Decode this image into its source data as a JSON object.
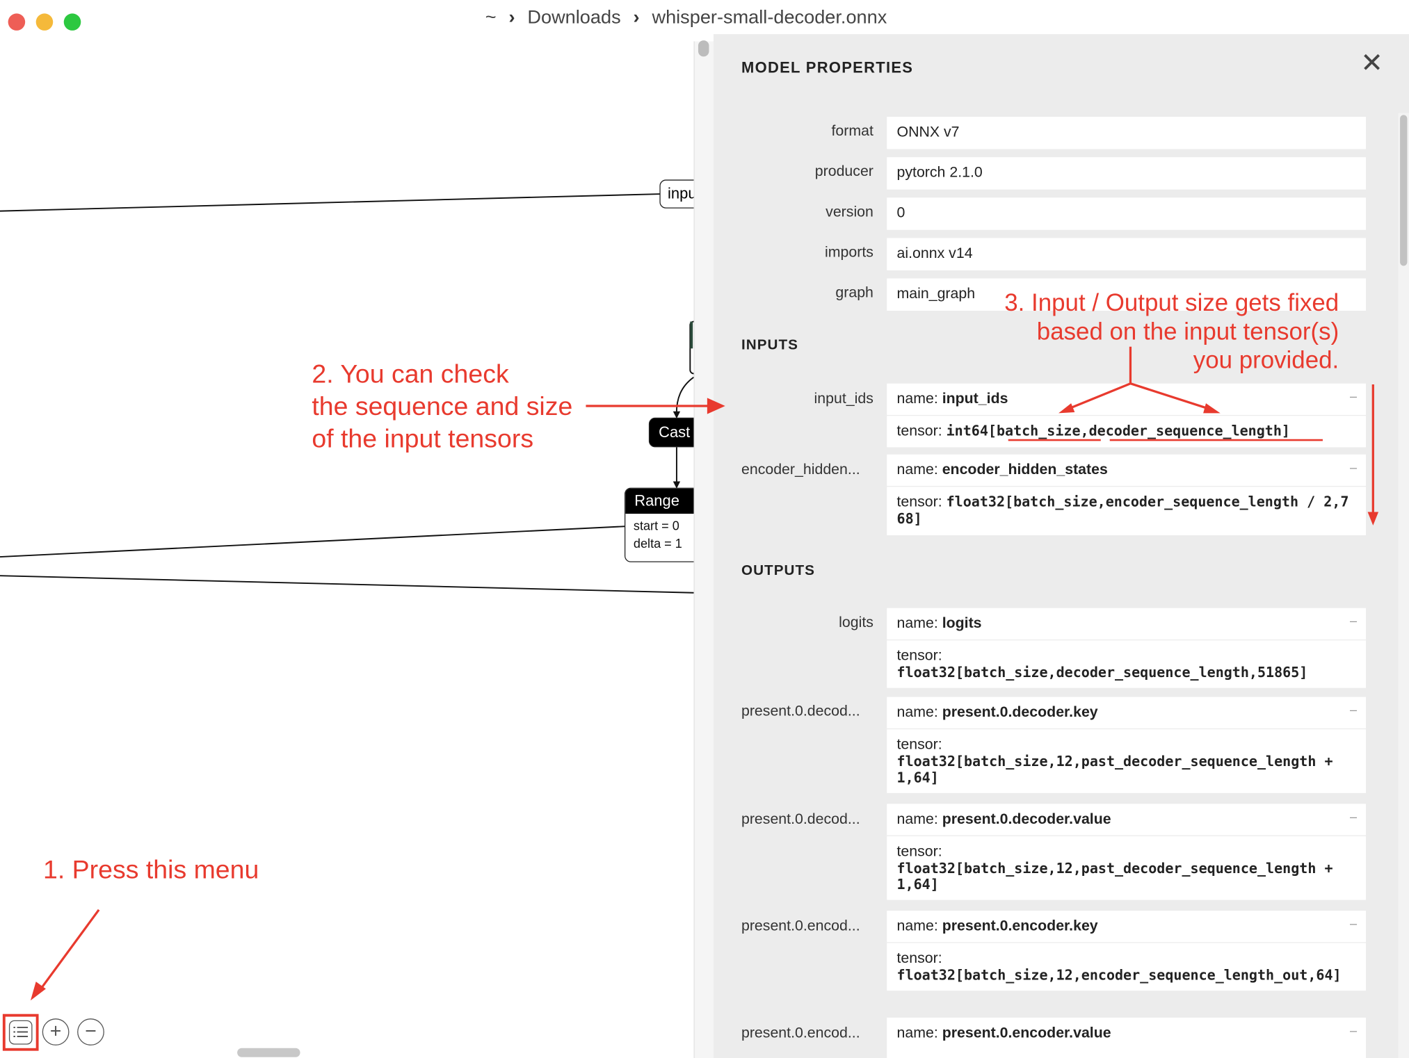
{
  "window": {
    "breadcrumb": [
      "~",
      "Downloads",
      "whisper-small-decoder.onnx"
    ],
    "separator": "›",
    "traffic_colors": [
      "#ee5e56",
      "#f5b93a",
      "#2cc840"
    ]
  },
  "graph": {
    "nodes": {
      "input_partial": "inpu",
      "cast": "Cast",
      "range": {
        "title": "Range",
        "attrs": [
          "start = 0",
          "delta = 1"
        ]
      }
    }
  },
  "toolbar": {
    "menu_icon": "list-icon",
    "zoom_in_icon": "zoom-in-icon",
    "zoom_out_icon": "zoom-out-icon",
    "zoom_in_glyph": "+",
    "zoom_out_glyph": "−"
  },
  "panel": {
    "title": "MODEL PROPERTIES",
    "close_glyph": "✕",
    "properties": [
      {
        "label": "format",
        "value": "ONNX v7"
      },
      {
        "label": "producer",
        "value": "pytorch 2.1.0"
      },
      {
        "label": "version",
        "value": "0"
      },
      {
        "label": "imports",
        "value": "ai.onnx v14"
      },
      {
        "label": "graph",
        "value": "main_graph"
      }
    ],
    "name_prefix": "name: ",
    "tensor_prefix": "tensor: ",
    "collapse_glyph": "–",
    "inputs_heading": "INPUTS",
    "inputs": [
      {
        "label": "input_ids",
        "name": "input_ids",
        "tensor": "int64[batch_size,decoder_sequence_length]"
      },
      {
        "label": "encoder_hidden...",
        "name": "encoder_hidden_states",
        "tensor": "float32[batch_size,encoder_sequence_length / 2,768]"
      }
    ],
    "outputs_heading": "OUTPUTS",
    "outputs": [
      {
        "label": "logits",
        "name": "logits",
        "tensor": "float32[batch_size,decoder_sequence_length,51865]"
      },
      {
        "label": "present.0.decod...",
        "name": "present.0.decoder.key",
        "tensor": "float32[batch_size,12,past_decoder_sequence_length + 1,64]"
      },
      {
        "label": "present.0.decod...",
        "name": "present.0.decoder.value",
        "tensor": "float32[batch_size,12,past_decoder_sequence_length + 1,64]"
      },
      {
        "label": "present.0.encod...",
        "name": "present.0.encoder.key",
        "tensor": "float32[batch_size,12,encoder_sequence_length_out,64]"
      },
      {
        "label": "present.0.encod...",
        "name": "present.0.encoder.value",
        "tensor": ""
      }
    ]
  },
  "annotations": {
    "step1": "1. Press this menu",
    "step2": [
      "2. You can check",
      "the sequence and size",
      "of the input tensors"
    ],
    "step3": [
      "3. Input / Output size gets fixed",
      "based on the input tensor(s)",
      "you provided."
    ],
    "color": "#e83a2e"
  }
}
